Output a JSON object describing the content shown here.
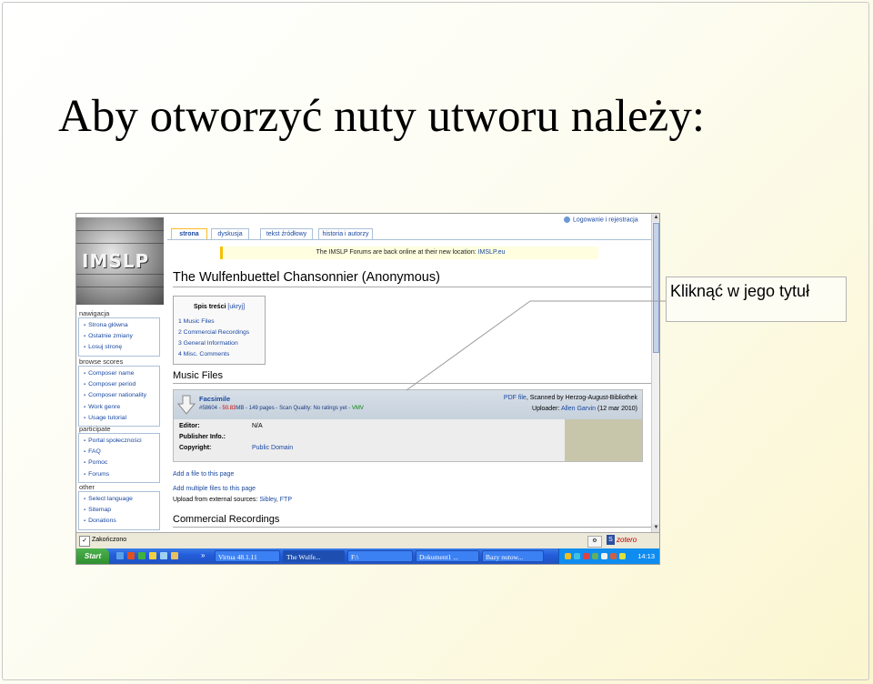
{
  "slide": {
    "title": "Aby otworzyć nuty utworu należy:",
    "callout": "Kliknąć w jego tytuł"
  },
  "browser": {
    "logo_text": "IMSLP",
    "user_tool": "Logowanie i rejestracja",
    "tabs": [
      {
        "label": "strona"
      },
      {
        "label": "dyskusja"
      },
      {
        "label": "tekst źródłowy"
      },
      {
        "label": "historia i autorzy"
      }
    ],
    "sitenotice": "The IMSLP Forums are back online at their new location:",
    "sitenotice_link": "IMSLP.eu",
    "page_title": "The Wulfenbuettel Chansonnier (Anonymous)",
    "toc": {
      "title": "Spis treści",
      "hide_label": "[ukryj]",
      "items": [
        "1 Music Files",
        "2 Commercial Recordings",
        "3 General Information",
        "4 Misc. Comments"
      ]
    },
    "sidebar": {
      "nav_heading": "nawigacja",
      "nav_items": [
        "Strona główna",
        "Ostatnie zmiany",
        "Losuj stronę"
      ],
      "browse_heading": "browse scores",
      "browse_items": [
        "Composer name",
        "Composer period",
        "Composer nationality",
        "Work genre",
        "Usage tutorial"
      ],
      "participate_heading": "participate",
      "participate_items": [
        "Portal społeczności",
        "FAQ",
        "Pomoc",
        "Forums"
      ],
      "other_heading": "other",
      "other_items": [
        "Select language",
        "Sitemap",
        "Donations"
      ]
    },
    "music_files_heading": "Music Files",
    "file": {
      "name": "Facsimile",
      "id": "#58604",
      "size": "50.83",
      "size_unit": "MB",
      "pages": "149 pages",
      "scan_quality_label": "Scan Quality:",
      "scan_quality_value": "No ratings yet",
      "vmv": "VMV",
      "pdf_link": "PDF file",
      "scanned_by": ", Scanned by Herzog-August-Bibliothek",
      "uploader_label": "Uploader:",
      "uploader_name": "Allen Garvin",
      "upload_date": "(12 mar 2010)",
      "editor_label": "Editor:",
      "editor_value": "N/A",
      "publisher_label": "Publisher Info.:",
      "copyright_label": "Copyright:",
      "copyright_value": "Public Domain"
    },
    "add_file": "Add a file to this page",
    "add_multiple": "Add multiple files to this page",
    "upload_external": "Upload from external sources:",
    "upload_sibley": "Sibley",
    "upload_ftp": "FTP",
    "commercial_heading": "Commercial Recordings",
    "status_text": "Zakończono",
    "zotero": "zotero"
  },
  "taskbar": {
    "start": "Start",
    "items": [
      "Virtua 48.1.11",
      "The Wulfe...",
      "F:\\",
      "Dokument1 ...",
      "Bazy nutow..."
    ],
    "clock": "14:13",
    "more": "»"
  }
}
